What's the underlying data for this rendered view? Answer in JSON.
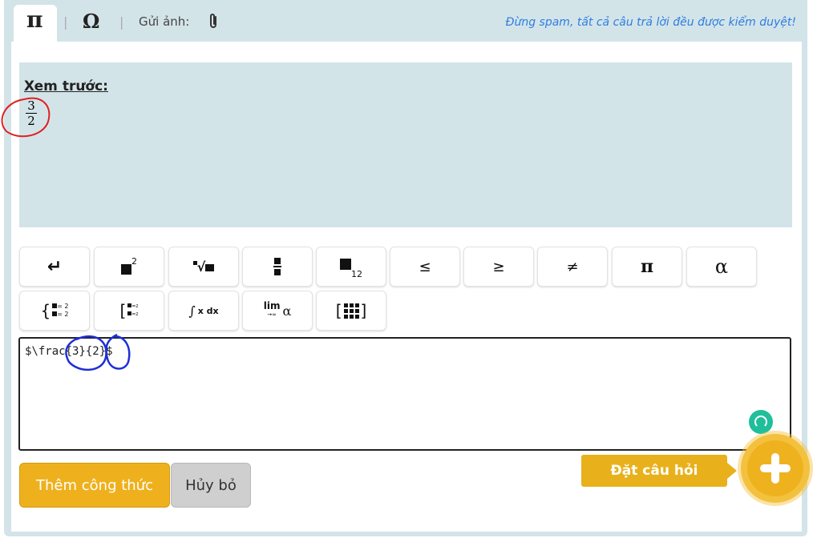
{
  "toolbar": {
    "tab_math_symbol": "π",
    "separator": "|",
    "tab_special_symbol": "Ω",
    "upload_label": "Gửi ảnh:",
    "notice": "Đừng spam, tất cả câu trả lời đều được kiểm duyệt!"
  },
  "preview": {
    "title": "Xem trước:",
    "fraction": {
      "numerator": "3",
      "denominator": "2"
    }
  },
  "keyboard": {
    "row1": {
      "enter": "↵",
      "power_exp": "2",
      "sqrt": "√",
      "subscript": "12",
      "leq": "≤",
      "geq": "≥",
      "neq": "≠",
      "pi": "π",
      "alpha": "α"
    },
    "row2": {
      "system_eq": "{",
      "system_val": "= 2",
      "bracket_eq": "[",
      "bracket_val": "=z",
      "integral_label": "x dx",
      "limit_label": "lim",
      "limit_sub": "→∞",
      "limit_alpha": "α",
      "matrix_l": "[",
      "matrix_r": "]"
    }
  },
  "editor": {
    "value": "$\\frac{3}{2}$"
  },
  "buttons": {
    "add_formula": "Thêm công thức",
    "cancel": "Hủy bỏ",
    "ask_question": "Đặt câu hỏi"
  },
  "colors": {
    "panel_bg": "#d3e4e9",
    "accent_yellow": "#eeb11d",
    "link_blue": "#2d7de0",
    "annotation_red": "#e02020",
    "annotation_blue": "#1e2fd6"
  }
}
